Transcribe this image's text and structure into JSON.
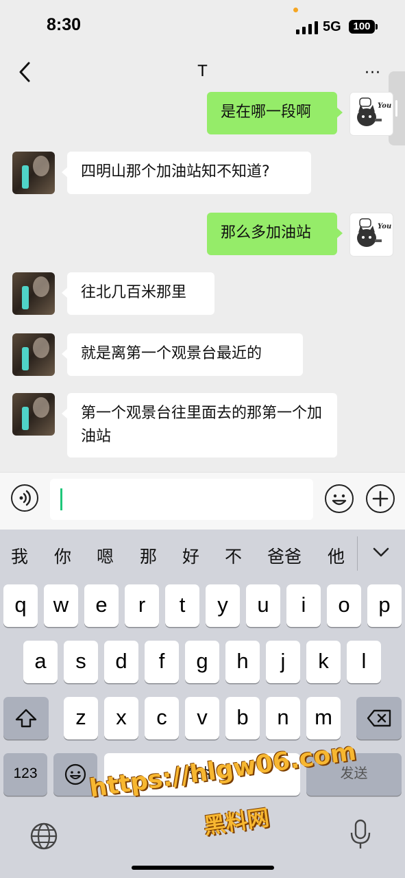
{
  "status_bar": {
    "time": "8:30",
    "network": "5G",
    "battery": "100"
  },
  "nav": {
    "title": "T",
    "more_label": "···"
  },
  "messages": [
    {
      "from": "me",
      "text": "是在哪一段啊"
    },
    {
      "from": "friend",
      "text": "四明山那个加油站知不知道?"
    },
    {
      "from": "me",
      "text": "那么多加油站"
    },
    {
      "from": "friend",
      "text": "往北几百米那里"
    },
    {
      "from": "friend",
      "text": "就是离第一个观景台最近的"
    },
    {
      "from": "friend",
      "text": "第一个观景台往里面去的那第一个加油站"
    }
  ],
  "my_avatar": {
    "caption": "You"
  },
  "input": {
    "value": ""
  },
  "candidates": [
    "我",
    "你",
    "嗯",
    "那",
    "好",
    "不",
    "爸爸",
    "他"
  ],
  "keyboard": {
    "row1": [
      "q",
      "w",
      "e",
      "r",
      "t",
      "y",
      "u",
      "i",
      "o",
      "p"
    ],
    "row2": [
      "a",
      "s",
      "d",
      "f",
      "g",
      "h",
      "j",
      "k",
      "l"
    ],
    "row3": [
      "z",
      "x",
      "c",
      "v",
      "b",
      "n",
      "m"
    ],
    "numbers_label": "123",
    "space_label": "空格",
    "return_label": "发送"
  },
  "watermark": {
    "url": "https://hlgw06.com",
    "name": "黑料网"
  },
  "colors": {
    "my_bubble": "#95ec69",
    "friend_bubble": "#ffffff",
    "background": "#ededed",
    "watermark": "#f7b731"
  }
}
